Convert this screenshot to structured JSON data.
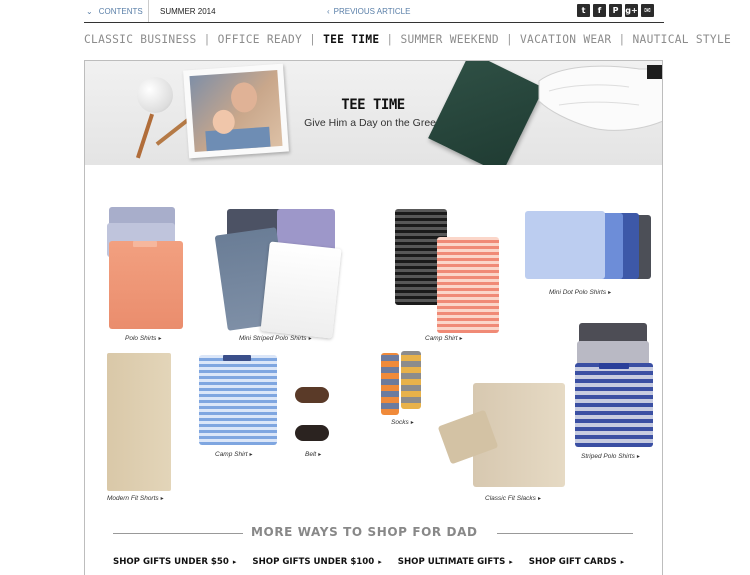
{
  "topbar": {
    "contents_label": "CONTENTS",
    "issue_label": "SUMMER 2014",
    "previous_label": "PREVIOUS ARTICLE",
    "social_icons": [
      "twitter-icon",
      "facebook-icon",
      "pinterest-icon",
      "google-plus-icon",
      "email-icon"
    ]
  },
  "categories": [
    {
      "label": "CLASSIC BUSINESS",
      "active": false
    },
    {
      "label": "OFFICE READY",
      "active": false
    },
    {
      "label": "TEE TIME",
      "active": true
    },
    {
      "label": "SUMMER WEEKEND",
      "active": false
    },
    {
      "label": "VACATION WEAR",
      "active": false
    },
    {
      "label": "NAUTICAL STYLE",
      "active": false
    }
  ],
  "banner": {
    "title": "TEE TIME",
    "subtitle": "Give Him a Day on the Green"
  },
  "products": [
    {
      "label": "Polo Shirts"
    },
    {
      "label": "Mini Striped Polo Shirts"
    },
    {
      "label": "Camp Shirt"
    },
    {
      "label": "Mini Dot Polo Shirts"
    },
    {
      "label": "Modern Fit Shorts"
    },
    {
      "label": "Camp Shirt"
    },
    {
      "label": "Belt"
    },
    {
      "label": "Socks"
    },
    {
      "label": "Classic Fit Slacks"
    },
    {
      "label": "Striped Polo Shirts"
    }
  ],
  "section": {
    "heading": "MORE WAYS TO SHOP FOR DAD"
  },
  "shop_links": [
    {
      "label": "SHOP GIFTS UNDER $50"
    },
    {
      "label": "SHOP GIFTS UNDER $100"
    },
    {
      "label": "SHOP ULTIMATE GIFTS"
    },
    {
      "label": "SHOP GIFT CARDS"
    }
  ],
  "arrow_glyph": "▸",
  "colors": {
    "link_blue": "#5a7fa8",
    "nav_gray": "#8c8c8c",
    "nav_active": "#111111"
  }
}
